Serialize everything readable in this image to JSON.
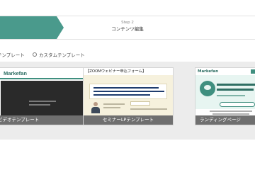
{
  "stepper": {
    "current_step_number": "Step 2",
    "current_step_title": "コンテンツ編集"
  },
  "template_type": {
    "options": [
      {
        "label": "テンプレート",
        "selected": true
      },
      {
        "label": "カスタムテンプレート",
        "selected": false
      }
    ]
  },
  "templates": [
    {
      "name": "ビデオテンプレート",
      "thumbnail_logo": "Markefan"
    },
    {
      "name": "セミナーLPテンプレート",
      "thumbnail_title": "【ZOOMウェビナー申込フォーム】"
    },
    {
      "name": "ランディングページ",
      "thumbnail_logo": "Markefan"
    }
  ],
  "colors": {
    "accent": "#4a9a8c",
    "caption_bg": "#6f6f6f",
    "gallery_bg": "#ececec"
  }
}
